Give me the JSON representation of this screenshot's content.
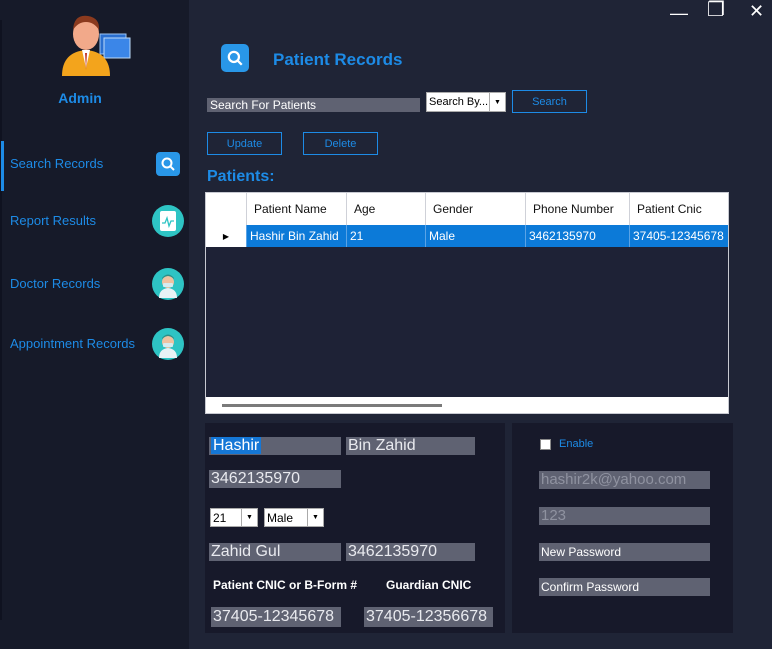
{
  "sidebar": {
    "admin_label": "Admin",
    "items": [
      {
        "label": "Search Records",
        "icon": "search-icon"
      },
      {
        "label": "Report Results",
        "icon": "report-icon"
      },
      {
        "label": "Doctor Records",
        "icon": "doctor-icon"
      },
      {
        "label": "Appointment Records",
        "icon": "doctor-icon"
      }
    ]
  },
  "window": {
    "minimize": "—",
    "maximize": "❐",
    "close": "✕"
  },
  "header": {
    "title": "Patient Records"
  },
  "search": {
    "input_value": "Search For Patients",
    "search_by": "Search By...",
    "search_button": "Search"
  },
  "actions": {
    "update": "Update",
    "delete": "Delete"
  },
  "patients_label": "Patients:",
  "table": {
    "columns": [
      "Patient Name",
      "Age",
      "Gender",
      "Phone Number",
      "Patient Cnic"
    ],
    "rows": [
      [
        "Hashir Bin Zahid",
        "21",
        "Male",
        "3462135970",
        "37405-12345678"
      ]
    ]
  },
  "form": {
    "first_name": "Hashir",
    "last_name": "Bin Zahid",
    "phone": "3462135970",
    "age": "21",
    "gender": "Male",
    "guardian_name": "Zahid Gul",
    "guardian_phone": "3462135970",
    "cnic_label": "Patient CNIC or B-Form #",
    "guardian_cnic_label": "Guardian CNIC",
    "cnic": "37405-12345678",
    "guardian_cnic": "37405-12356678"
  },
  "account": {
    "enable_label": "Enable",
    "email": "hashir2k@yahoo.com",
    "password": "123",
    "new_password": "New Password",
    "confirm_password": "Confirm Password"
  },
  "colors": {
    "accent": "#1d8be6",
    "sidebar": "#161a29",
    "background": "#1f2436",
    "selected_row": "#0c7ad8"
  }
}
